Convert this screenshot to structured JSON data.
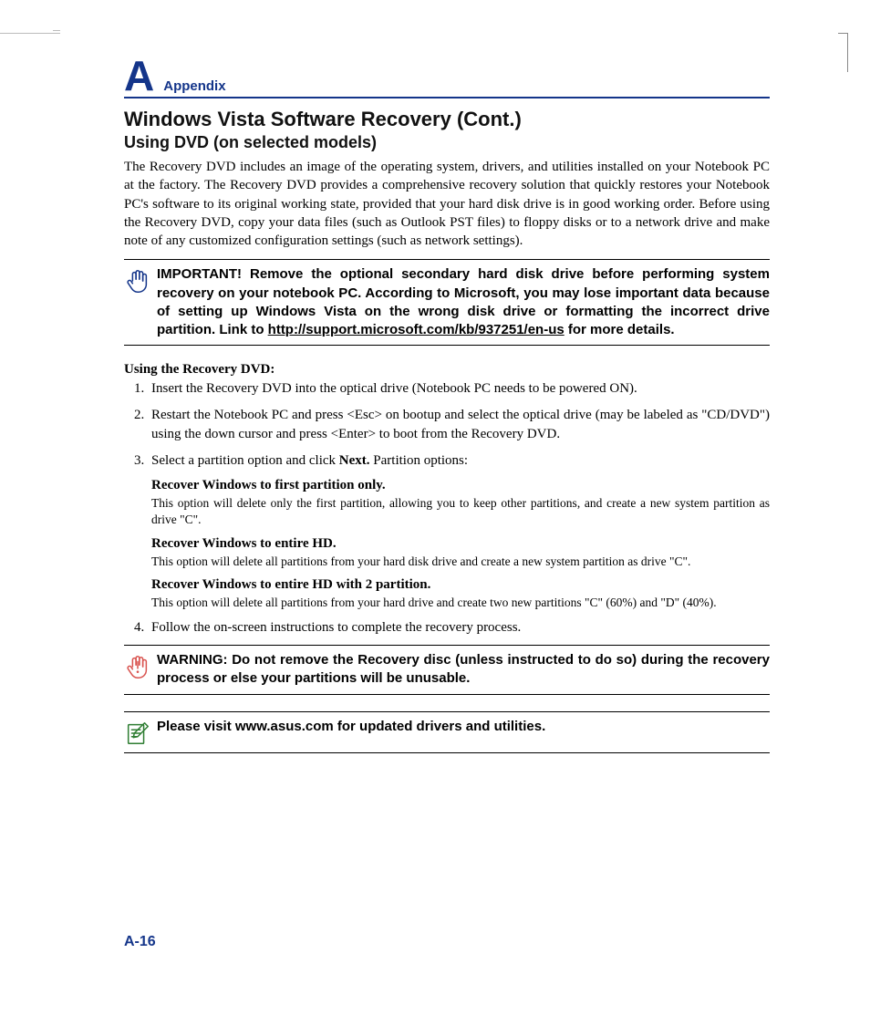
{
  "section": {
    "letter": "A",
    "label": "Appendix"
  },
  "title": "Windows Vista Software Recovery (Cont.)",
  "subtitle": "Using DVD (on selected models)",
  "intro": "The Recovery DVD includes an image of the operating system, drivers, and utilities installed on your Notebook PC at the factory. The Recovery DVD provides a comprehensive recovery solution that quickly restores your Notebook PC's software to its original working state, provided that your hard disk drive is in good working order. Before using the Recovery DVD, copy your data files (such as Outlook PST files) to floppy disks or to a network drive and make note of any customized configuration settings (such as network settings).",
  "important": {
    "pre": "IMPORTANT! Remove the optional secondary hard disk drive before performing system recovery on your notebook PC. According to Microsoft, you may lose important data because of setting up Windows Vista on the wrong disk drive or formatting the incorrect drive partition. Link to ",
    "link": "http://support.microsoft.com/kb/937251/en-us",
    "post": " for more details."
  },
  "steps_heading": "Using the Recovery DVD:",
  "steps": {
    "s1": "Insert the Recovery DVD into the optical drive (Notebook PC needs to be powered ON).",
    "s2": "Restart the Notebook PC and press <Esc> on bootup and select the optical drive (may be labeled as \"CD/DVD\") using the down cursor and press <Enter> to boot from the Recovery DVD.",
    "s3_pre": "Select a partition option and click ",
    "s3_bold": "Next.",
    "s3_post": " Partition options:",
    "opts": {
      "a_title": "Recover Windows to first partition only.",
      "a_desc": "This option will delete only the first partition, allowing you to keep other partitions, and create a new system partition as drive \"C\".",
      "b_title": "Recover Windows to entire HD.",
      "b_desc": "This option will delete all partitions from your hard disk drive and create a new system partition as drive \"C\".",
      "c_title": "Recover Windows to entire HD with 2 partition.",
      "c_desc": "This option will delete all partitions from your hard drive and create two new partitions \"C\" (60%) and \"D\" (40%)."
    },
    "s4": "Follow the on-screen instructions to complete the recovery process."
  },
  "warning": "WARNING: Do not remove the Recovery disc (unless instructed to do so) during the recovery process or else your partitions will be unusable.",
  "note": "Please visit www.asus.com for updated drivers and utilities.",
  "page_number": "A-16"
}
